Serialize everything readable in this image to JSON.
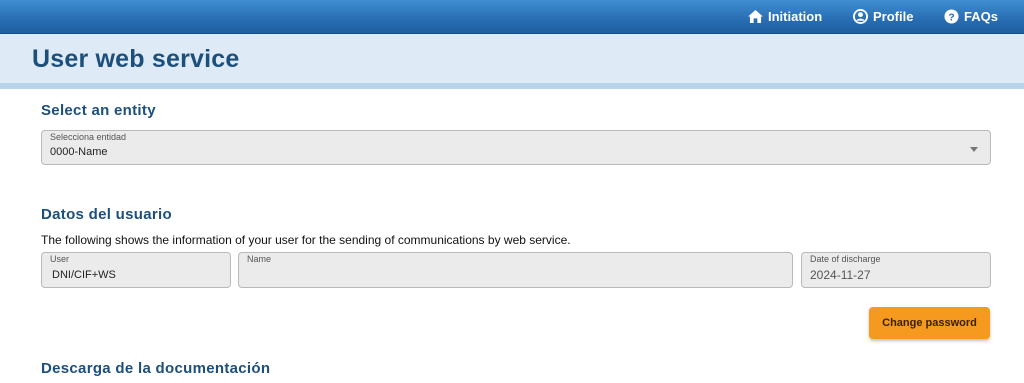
{
  "nav": {
    "initiation": "Initiation",
    "profile": "Profile",
    "faqs": "FAQs"
  },
  "page": {
    "title": "User web service"
  },
  "entity": {
    "section_title": "Select an entity",
    "select_label": "Selecciona entidad",
    "select_value": "0000-Name"
  },
  "user_data": {
    "section_title": "Datos del usuario",
    "description": "The following shows the information of your user for the sending of communications by web service.",
    "user_label": "User",
    "user_value": "DNI/CIF+WS",
    "name_label": "Name",
    "name_value": "",
    "date_label": "Date of discharge",
    "date_value": "2024-11-27",
    "change_password": "Change password"
  },
  "download": {
    "section_title": "Descarga de la documentación"
  },
  "colors": {
    "nav_bar": "#2a6fb4",
    "title": "#1d4f7c",
    "button": "#f59a1e",
    "band": "#deebf6"
  },
  "icons": {
    "initiation": "home-icon",
    "profile": "user-circle-icon",
    "faqs": "question-circle-icon"
  }
}
